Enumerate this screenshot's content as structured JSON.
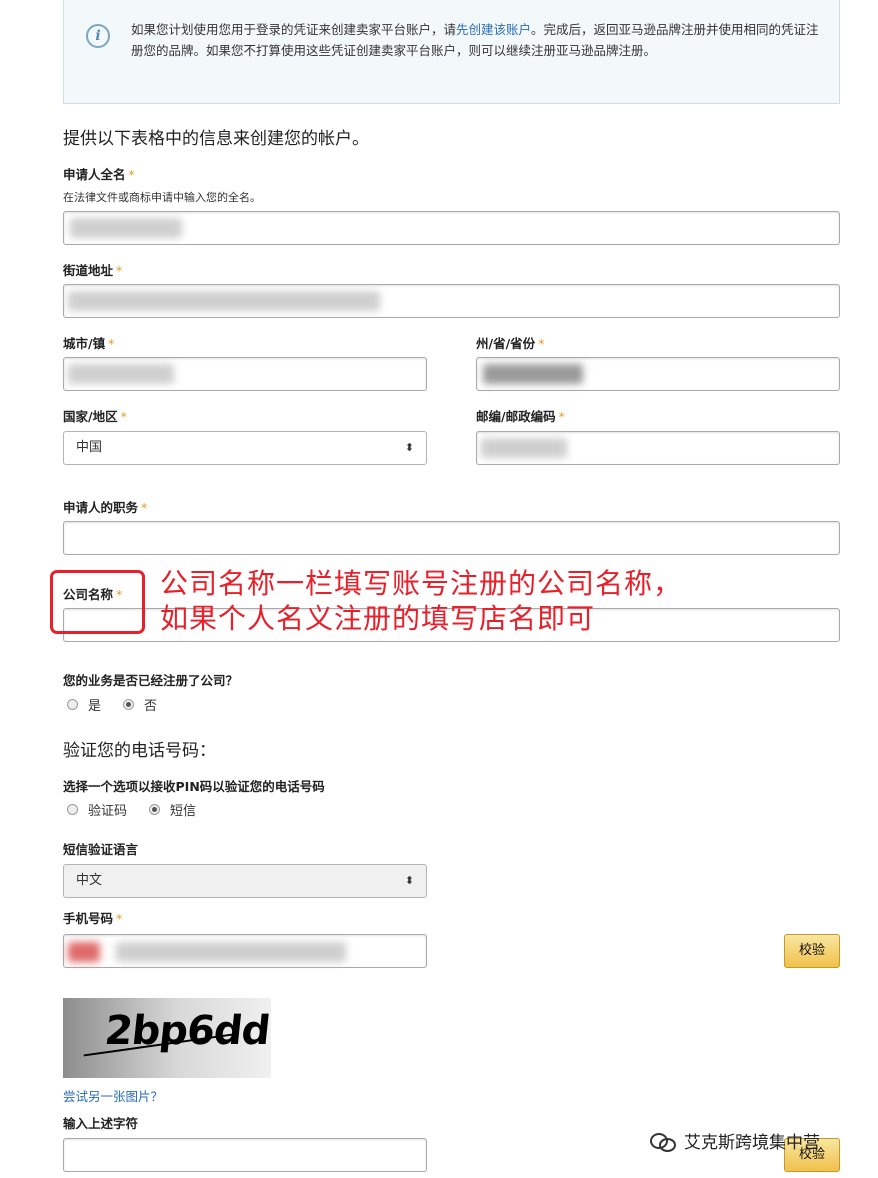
{
  "info": {
    "text_before_link": "如果您计划使用您用于登录的凭证来创建卖家平台账户，请",
    "link": "先创建该账户",
    "text_after_link": "。完成后，返回亚马逊品牌注册并使用相同的凭证注册您的品牌。如果您不打算使用这些凭证创建卖家平台账户，则可以继续注册亚马逊品牌注册。"
  },
  "form": {
    "section_title": "提供以下表格中的信息来创建您的帐户。",
    "applicant_name": {
      "label": "申请人全名",
      "hint": "在法律文件或商标申请中输入您的全名。"
    },
    "street": {
      "label": "街道地址"
    },
    "city": {
      "label": "城市/镇"
    },
    "state": {
      "label": "州/省/省份"
    },
    "country": {
      "label": "国家/地区",
      "value": "中国"
    },
    "zip": {
      "label": "邮编/邮政编码"
    },
    "title": {
      "label": "申请人的职务"
    },
    "company": {
      "label": "公司名称"
    },
    "registered": {
      "question": "您的业务是否已经注册了公司？",
      "options": [
        "是",
        "否"
      ],
      "selected": "否"
    },
    "required_mark": "*"
  },
  "phone": {
    "section_title": "验证您的电话号码：",
    "method_label": "选择一个选项以接收PIN码以验证您的电话号码",
    "options": [
      "验证码",
      "短信"
    ],
    "selected": "短信",
    "sms_lang_label": "短信验证语言",
    "sms_lang_value": "中文",
    "mobile_label": "手机号码",
    "verify_button": "校验"
  },
  "captcha": {
    "image_text": "2bp6dd",
    "refresh_link": "尝试另一张图片？",
    "input_label": "输入上述字符",
    "verify_button": "校验"
  },
  "annotation": {
    "line1": "公司名称一栏填写账号注册的公司名称，",
    "line2": "如果个人名义注册的填写店名即可",
    "color": "#e8202a"
  },
  "watermark": {
    "text": "艾克斯跨境集中营"
  }
}
